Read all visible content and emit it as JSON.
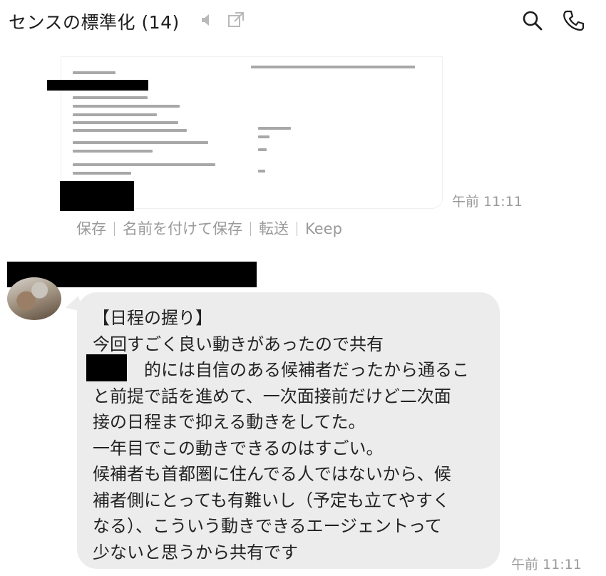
{
  "header": {
    "title": "センスの標準化 (14)",
    "icons": [
      "speaker-muted-icon",
      "open-external-icon",
      "search-icon",
      "phone-icon"
    ]
  },
  "image_message": {
    "time": "午前 11:11",
    "actions": {
      "save": "保存",
      "save_as": "名前を付けて保存",
      "forward": "転送",
      "keep": "Keep"
    }
  },
  "text_message": {
    "body": "【日程の握り】\n今回すごく良い動きがあったので共有\n　　　的には自信のある候補者だったから通るこ\nと前提で話を進めて、一次面接前だけど二次面\n接の日程まで抑える動きをしてた。\n一年目でこの動きできるのはすごい。\n候補者も首都圏に住んでる人ではないから、候\n補者側にとっても有難いし（予定も立てやすく\nなる）、こういう動きできるエージェントって\n少ないと思うから共有です",
    "time": "午前 11:11"
  },
  "colors": {
    "bubble": "#ececec",
    "timestamp": "#9a9a9a",
    "redaction": "#000000"
  }
}
